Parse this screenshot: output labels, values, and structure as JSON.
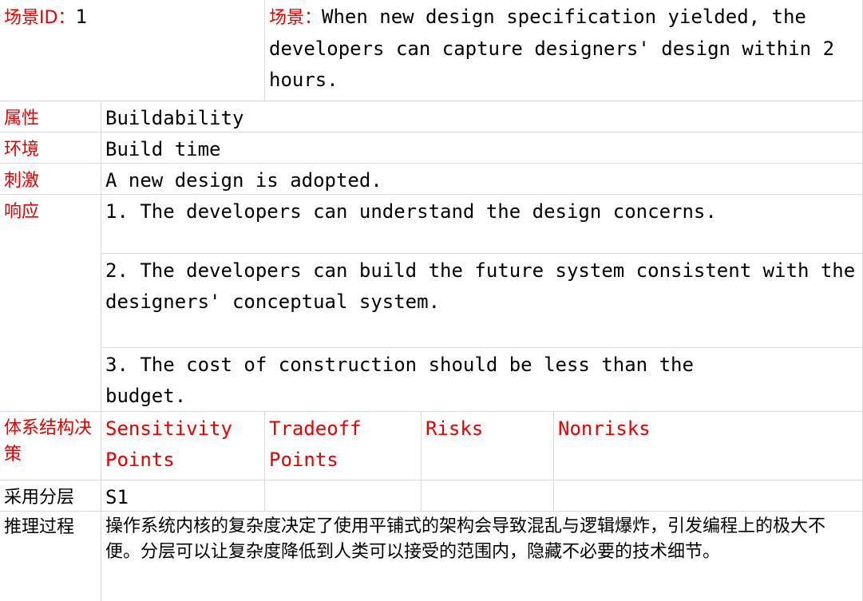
{
  "scenario": {
    "id_label": "场景ID：",
    "id_value": "1",
    "scenario_label": "场景：",
    "scenario_text": "When new design specification yielded, the developers can capture designers' design within 2 hours."
  },
  "rows": {
    "attribute": {
      "label": "属性",
      "value": "Buildability"
    },
    "environment": {
      "label": "环境",
      "value": "Build time"
    },
    "stimulus": {
      "label": "刺激",
      "value": "A new design is adopted."
    },
    "response": {
      "label": "响应",
      "items": [
        "1. The developers can understand the design concerns.",
        "2. The developers can build the future system consistent with the designers' conceptual system.",
        "3. The cost of construction should be less than the budget."
      ]
    },
    "architecture": {
      "label": "体系结构决策",
      "headers": [
        "Sensitivity Points",
        "Tradeoff Points",
        "Risks",
        "Nonrisks"
      ]
    },
    "layer": {
      "label": "采用分层",
      "value": "S1",
      "sensitivity": "",
      "tradeoff": "",
      "risks": "",
      "nonrisks": ""
    },
    "reasoning": {
      "label": "推理过程",
      "text": "操作系统内核的复杂度决定了使用平铺式的架构会导致混乱与逻辑爆炸，引发编程上的极大不便。分层可以让复杂度降低到人类可以接受的范围内，隐藏不必要的技术细节。"
    }
  }
}
